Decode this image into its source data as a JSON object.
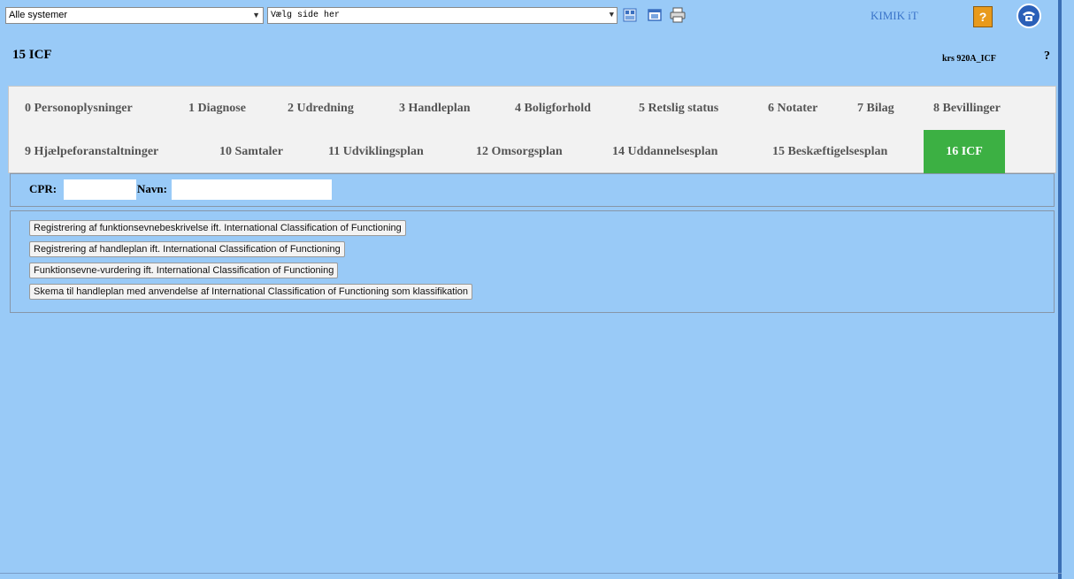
{
  "toolbar": {
    "system_select": "Alle systemer",
    "page_select": "Vælg side her",
    "brand": "KIMIK iT",
    "help_label": "?",
    "icons": [
      "window-icon",
      "minimize-icon",
      "print-icon",
      "help-icon",
      "phone-icon"
    ]
  },
  "header": {
    "title": "15 ICF",
    "form_code": "krs 920A_ICF",
    "help": "?"
  },
  "tabs": [
    {
      "label": "0 Personoplysninger"
    },
    {
      "label": "1 Diagnose"
    },
    {
      "label": "2 Udredning"
    },
    {
      "label": "3 Handleplan"
    },
    {
      "label": "4 Boligforhold"
    },
    {
      "label": "5 Retslig status"
    },
    {
      "label": "6 Notater"
    },
    {
      "label": "7 Bilag"
    },
    {
      "label": "8 Bevillinger"
    },
    {
      "label": "9 Hjælpeforanstaltninger"
    },
    {
      "label": "10 Samtaler"
    },
    {
      "label": "11 Udviklingsplan"
    },
    {
      "label": "12 Omsorgsplan"
    },
    {
      "label": "14 Uddannelsesplan"
    },
    {
      "label": "15 Beskæftigelsesplan"
    },
    {
      "label": "16 ICF",
      "active": true
    }
  ],
  "patient": {
    "cpr_label": "CPR:",
    "name_label": "Navn:"
  },
  "links": [
    "Registrering af funktionsevnebeskrivelse ift. International Classification of Functioning",
    "Registrering af handleplan ift. International Classification of Functioning",
    "Funktionsevne-vurdering ift. International Classification of Functioning",
    "Skema til handleplan med anvendelse af International Classification of Functioning som klassifikation"
  ],
  "colors": {
    "background": "#99caf7",
    "active_tab": "#3cb043",
    "tab_bar": "#f2f2f2"
  }
}
